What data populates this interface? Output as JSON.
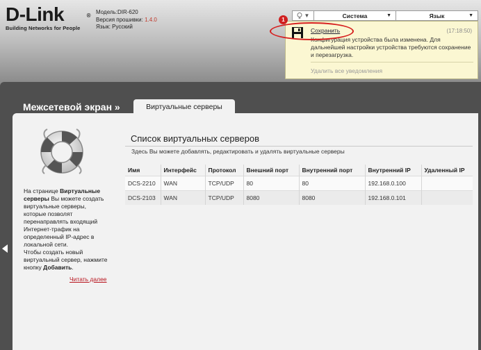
{
  "header": {
    "logo_text": "D-Link",
    "logo_tm": "®",
    "logo_tagline": "Building Networks for People",
    "model_label": "Модель:",
    "model_value": "DIR-620",
    "firmware_label": "Версия прошивки:",
    "firmware_value": "1.4.0",
    "language_label": "Язык:",
    "language_value": "Русский"
  },
  "topbar": {
    "notification_count": "1",
    "system_label": "Система",
    "language_menu_label": "Язык",
    "dropdown_arrow": "▼"
  },
  "notification": {
    "save_label": "Сохранить",
    "time": "(17:18:50)",
    "message": "Конфигурация устройства была изменена. Для дальнейшей настройки устройства требуются сохранение и перезагрузка.",
    "clear_all": "Удалить все уведомления"
  },
  "section": {
    "title": "Межсетевой экран »",
    "active_tab": "Виртуальные серверы"
  },
  "help": {
    "p1_prefix": "На странице ",
    "p1_bold": "Виртуальные серверы",
    "p1_suffix": " Вы можете создать виртуальные серверы, которые позволят перенаправлять входящий Интернет-трафик на определенный IP-адрес в локальной сети.",
    "p2_prefix": "Чтобы создать новый виртуальный сервер, нажмите кнопку ",
    "p2_bold": "Добавить",
    "p2_suffix": ".",
    "read_more": "Читать далее"
  },
  "list": {
    "title": "Список виртуальных серверов",
    "subtitle": "Здесь Вы можете добавлять, редактировать и удалять виртуальные серверы",
    "columns": [
      "Имя",
      "Интерфейс",
      "Протокол",
      "Внешний порт",
      "Внутренний порт",
      "Внутренний IP",
      "Удаленный IP"
    ],
    "rows": [
      [
        "DCS-2210",
        "WAN",
        "TCP/UDP",
        "80",
        "80",
        "192.168.0.100",
        ""
      ],
      [
        "DCS-2103",
        "WAN",
        "TCP/UDP",
        "8080",
        "8080",
        "192.168.0.101",
        ""
      ]
    ]
  },
  "icons": {
    "bulb": "lightbulb-icon",
    "save": "floppy-disk-icon",
    "help": "lifebuoy-icon",
    "collapse": "chevron-left-icon"
  },
  "colors": {
    "accent_red": "#c0392b",
    "notification_bg": "#fbf7d2",
    "content_bg": "#f2f2f2",
    "dark_bg": "#4f4f4f"
  }
}
